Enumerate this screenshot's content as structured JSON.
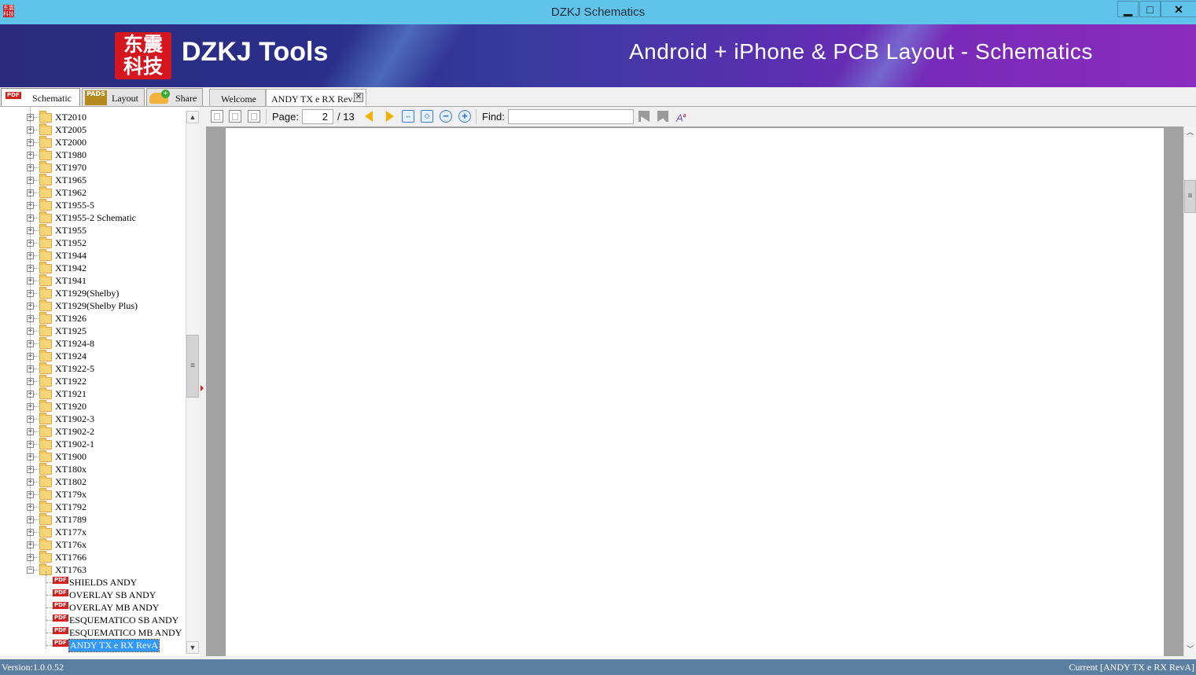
{
  "window": {
    "title": "DZKJ Schematics",
    "app_icon_text": "东震科技",
    "controls": {
      "minimize": "▁",
      "maximize": "□",
      "close": "✕"
    }
  },
  "banner": {
    "logo_text": "东震科技",
    "brand": "DZKJ Tools",
    "tagline": "Android + iPhone & PCB Layout - Schematics"
  },
  "left_tabs": [
    {
      "label": "Schematic",
      "icon": "pdf-icon",
      "active": true
    },
    {
      "label": "Layout",
      "icon": "pads-icon",
      "icon_text": "PADS"
    },
    {
      "label": "Share",
      "icon": "cloud-add-icon"
    }
  ],
  "doc_tabs": [
    {
      "label": "Welcome"
    },
    {
      "label": "ANDY TX e RX RevA",
      "active": true,
      "close": "✕"
    }
  ],
  "tree": {
    "folders": [
      "XT2010",
      "XT2005",
      "XT2000",
      "XT1980",
      "XT1970",
      "XT1965",
      "XT1962",
      "XT1955-5",
      "XT1955-2 Schematic",
      "XT1955",
      "XT1952",
      "XT1944",
      "XT1942",
      "XT1941",
      "XT1929(Shelby)",
      "XT1929(Shelby Plus)",
      "XT1926",
      "XT1925",
      "XT1924-8",
      "XT1924",
      "XT1922-5",
      "XT1922",
      "XT1921",
      "XT1920",
      "XT1902-3",
      "XT1902-2",
      "XT1902-1",
      "XT1900",
      "XT180x",
      "XT1802",
      "XT179x",
      "XT1792",
      "XT1789",
      "XT177x",
      "XT176x",
      "XT1766"
    ],
    "expanded_folder": "XT1763",
    "files": [
      "SHIELDS ANDY",
      "OVERLAY SB ANDY",
      "OVERLAY MB ANDY",
      "ESQUEMATICO SB ANDY",
      "ESQUEMATICO MB ANDY",
      "ANDY TX e RX RevA"
    ],
    "selected_file": "ANDY TX e RX RevA",
    "file_badge": "PDF"
  },
  "toolbar": {
    "page_label": "Page:",
    "page_current": "2",
    "page_total": "/ 13",
    "find_label": "Find:",
    "find_value": ""
  },
  "status": {
    "version": "Version:1.0.0.52",
    "current": "Current [ANDY TX e RX RevA]"
  },
  "colors": {
    "titlebar": "#60c4ea",
    "banner_left": "#2a2b7a",
    "banner_right": "#8a2cbe",
    "logo_red": "#d6161f",
    "selection": "#3399ff",
    "statusbar": "#5b7fa0",
    "nav_arrow": "#f0b400"
  }
}
